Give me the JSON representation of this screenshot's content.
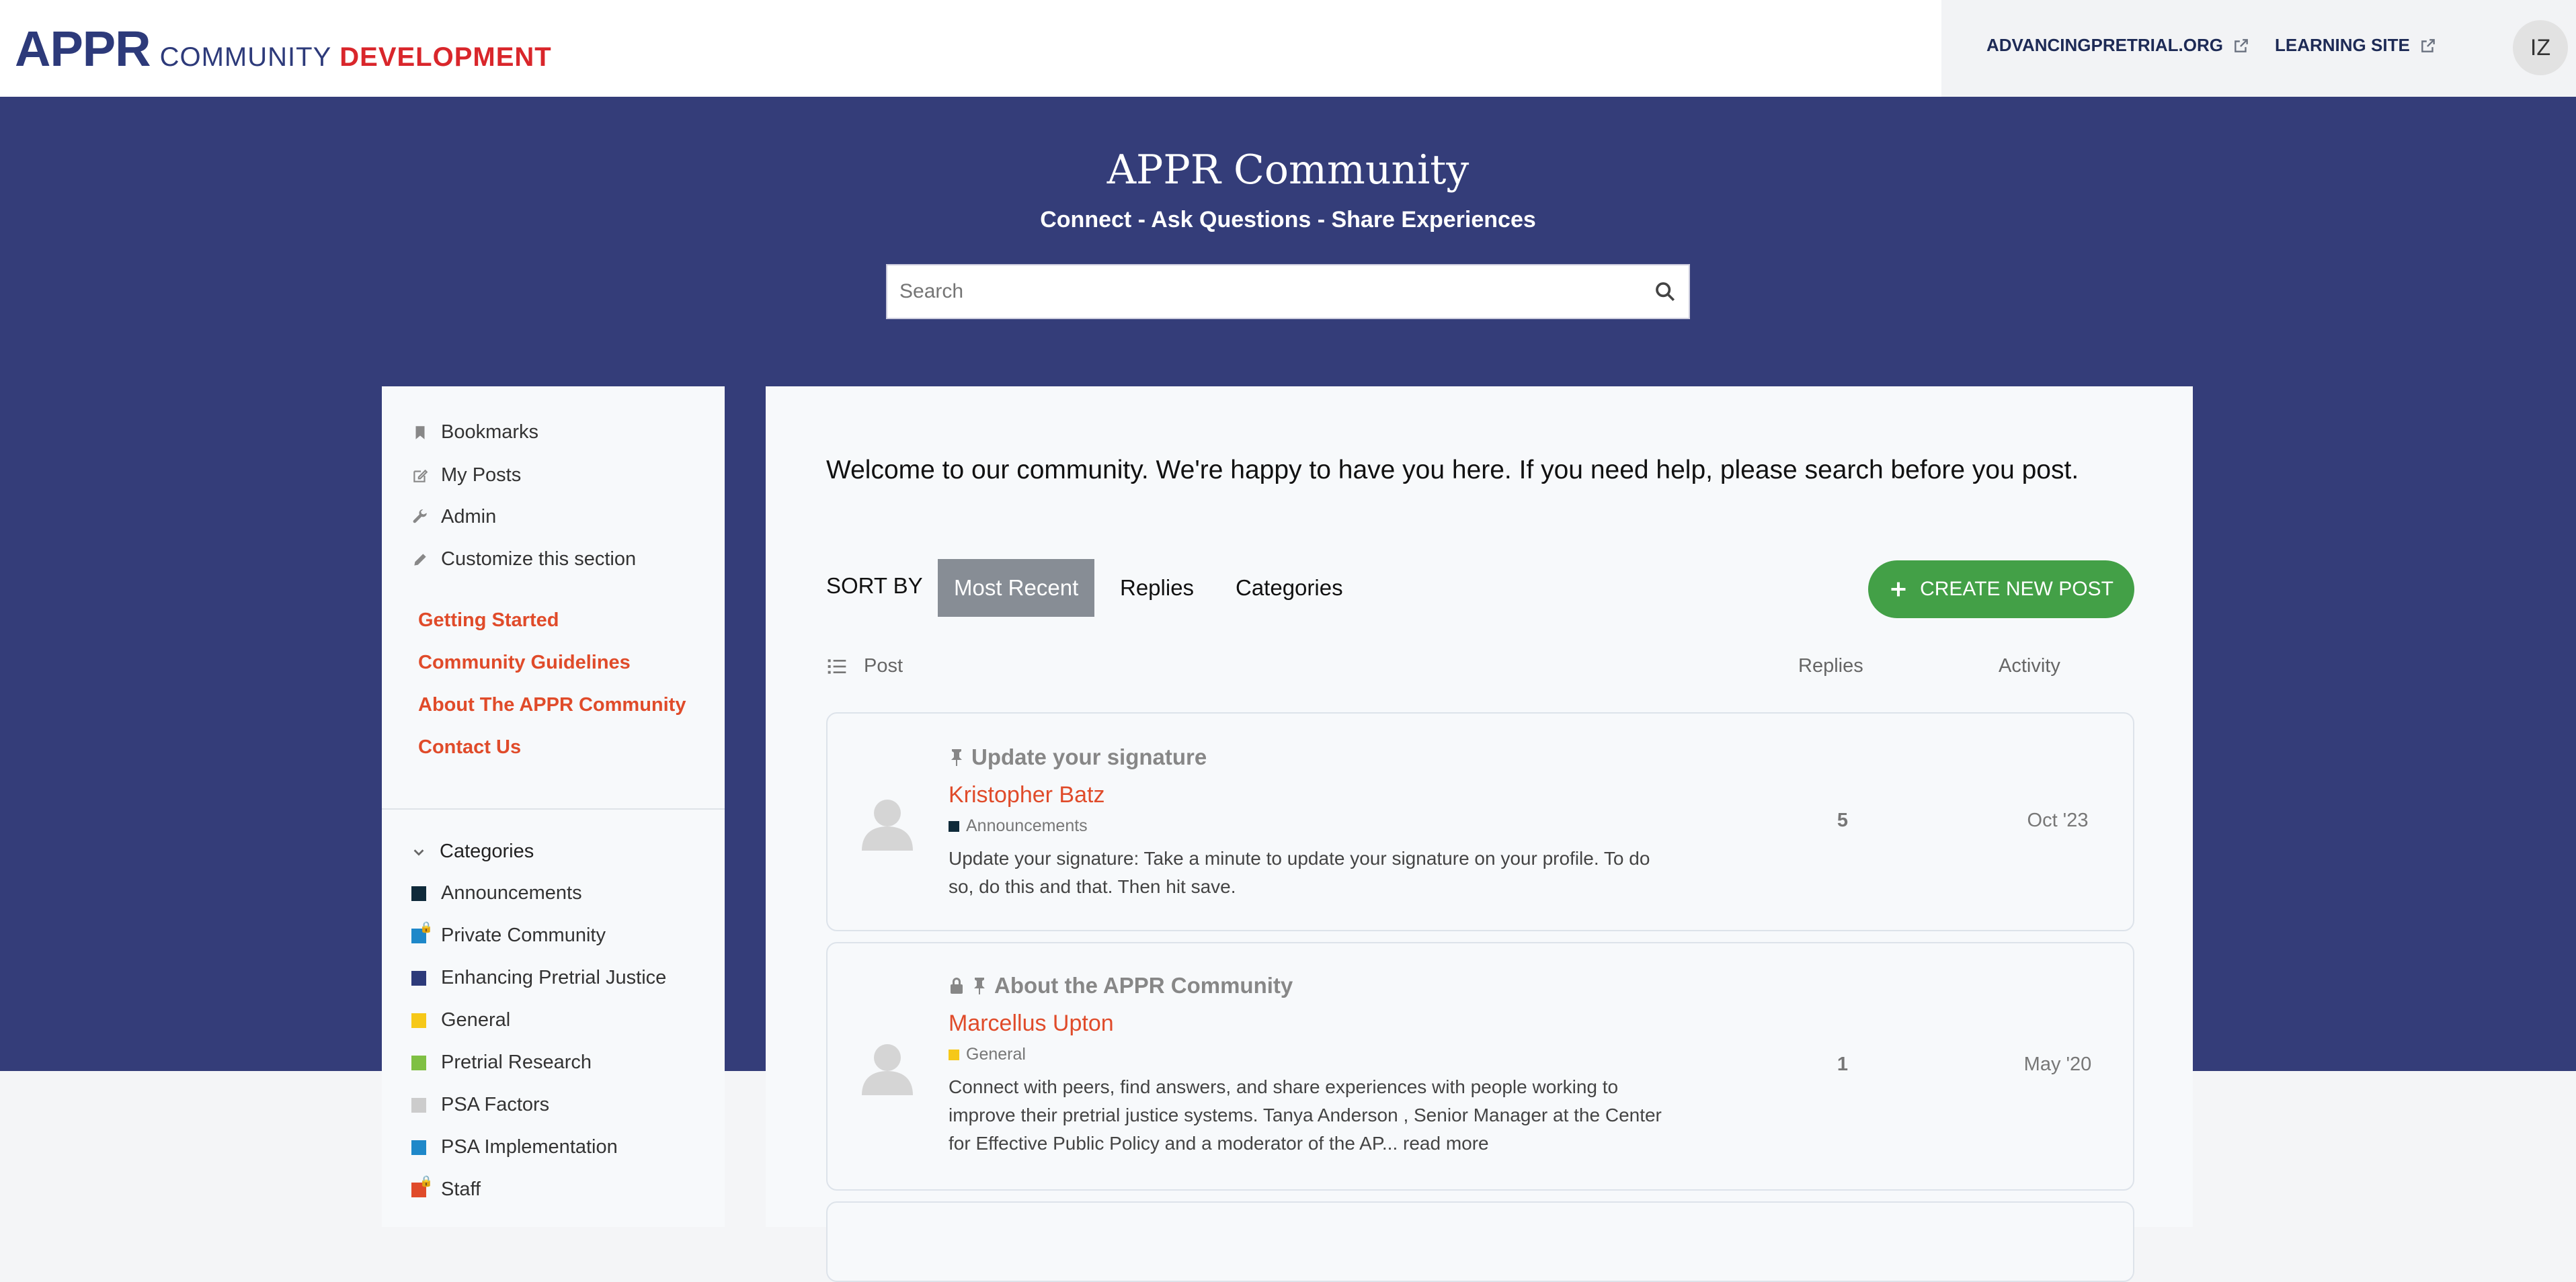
{
  "header": {
    "logo_main": "APPR",
    "logo_sub": "COMMUNITY",
    "logo_sub2": "DEVELOPMENT",
    "links": [
      {
        "label": "ADVANCINGPRETRIAL.ORG",
        "icon": "external-link-icon"
      },
      {
        "label": "LEARNING SITE",
        "icon": "external-link-icon"
      }
    ],
    "avatar_initials": "IZ"
  },
  "hero": {
    "title": "APPR Community",
    "subtitle": "Connect - Ask Questions - Share Experiences",
    "search_placeholder": "Search"
  },
  "sidebar": {
    "items": [
      {
        "label": "Bookmarks",
        "icon": "bookmark-icon"
      },
      {
        "label": "My Posts",
        "icon": "edit-icon"
      },
      {
        "label": "Admin",
        "icon": "wrench-icon"
      },
      {
        "label": "Customize this section",
        "icon": "pencil-icon"
      }
    ],
    "links": [
      {
        "label": "Getting Started"
      },
      {
        "label": "Community Guidelines"
      },
      {
        "label": "About The APPR Community"
      },
      {
        "label": "Contact Us"
      }
    ],
    "categories_header": "Categories",
    "categories": [
      {
        "label": "Announcements",
        "color": "#0f2a3a",
        "locked": false
      },
      {
        "label": "Private Community",
        "color": "#1e88c9",
        "locked": true
      },
      {
        "label": "Enhancing Pretrial Justice",
        "color": "#2d3a7a",
        "locked": false
      },
      {
        "label": "General",
        "color": "#f6c818",
        "locked": false
      },
      {
        "label": "Pretrial Research",
        "color": "#7fc043",
        "locked": false
      },
      {
        "label": "PSA Factors",
        "color": "#cccccc",
        "locked": false
      },
      {
        "label": "PSA Implementation",
        "color": "#1e88c9",
        "locked": false
      },
      {
        "label": "Staff",
        "color": "#e04b2a",
        "locked": true
      }
    ]
  },
  "main": {
    "welcome": "Welcome to our community. We're happy to have you here. If you need help, please search before you post.",
    "sort_label": "SORT BY",
    "sort_options": [
      {
        "label": "Most Recent",
        "active": true
      },
      {
        "label": "Replies",
        "active": false
      },
      {
        "label": "Categories",
        "active": false
      }
    ],
    "create_label": "CREATE NEW POST",
    "columns": {
      "post": "Post",
      "replies": "Replies",
      "activity": "Activity"
    },
    "posts": [
      {
        "title": "Update your signature",
        "pinned": true,
        "locked": false,
        "author": "Kristopher Batz",
        "category": "Announcements",
        "category_color": "#0f2a3a",
        "excerpt_lines": [
          "Update your signature: Take a minute to update your signature on your profile. To do",
          "so, do this and that. Then hit save."
        ],
        "replies": "5",
        "activity": "Oct '23"
      },
      {
        "title": "About the APPR Community",
        "pinned": true,
        "locked": true,
        "author": "Marcellus Upton",
        "category": "General",
        "category_color": "#f6c818",
        "excerpt_lines": [
          "Connect with peers, find answers, and share experiences with people working to",
          "improve their pretrial justice systems. Tanya Anderson , Senior Manager at the Center",
          "for Effective Public Policy and a moderator of the AP... read more"
        ],
        "replies": "1",
        "activity": "May '20"
      }
    ]
  }
}
